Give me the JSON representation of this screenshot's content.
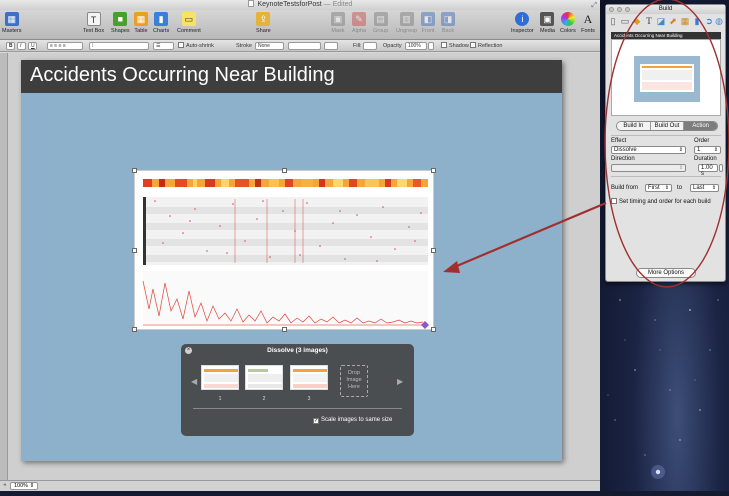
{
  "window": {
    "title": "KeynoteTestsforPost",
    "edited": "— Edited"
  },
  "toolbar": {
    "masters": "Masters",
    "text_box": "Text Box",
    "shapes": "Shapes",
    "table": "Table",
    "charts": "Charts",
    "comment": "Comment",
    "share": "Share",
    "mask": "Mask",
    "alpha": "Alpha",
    "group": "Group",
    "ungroup": "Ungroup",
    "front": "Front",
    "back": "Back",
    "inspector": "Inspector",
    "media": "Media",
    "colors": "Colors",
    "fonts": "Fonts"
  },
  "format_bar": {
    "bold": "B",
    "italic": "I",
    "underline": "U",
    "auto_shrink": "Auto-shrink",
    "stroke_label": "Stroke",
    "stroke_value": "None",
    "fill_label": "Fill:",
    "opacity_label": "Opacity",
    "opacity_value": "100%",
    "shadow_label": "Shadow",
    "reflection_label": "Reflection"
  },
  "slide": {
    "title": "Accidents Occurring Near Building"
  },
  "build_hud": {
    "title": "Dissolve (3 images)",
    "thumbnails": [
      {
        "number": "1"
      },
      {
        "number": "2"
      },
      {
        "number": "3"
      }
    ],
    "drop_text": "Drop Image Here",
    "scale_checkbox_label": "Scale images to same size",
    "scale_checked": true
  },
  "status": {
    "zoom": "100%"
  },
  "inspector": {
    "title": "Build",
    "preview_title": "Accidents Occurring Near Building",
    "tabs": [
      "Build In",
      "Build Out",
      "Action"
    ],
    "active_tab": "Action",
    "effect_label": "Effect",
    "effect_value": "Dissolve",
    "order_label": "Order",
    "order_value": "1",
    "direction_label": "Direction",
    "duration_label": "Duration",
    "duration_value": "1.00 s",
    "build_from_label": "Build from",
    "build_from_value": "First",
    "to_label": "to",
    "to_value": "Last",
    "set_timing_label": "Set timing and order for each build",
    "more_options": "More Options"
  },
  "colors": {
    "slide_bg": "#8eb1cb",
    "title_bar": "#3e3e3e",
    "annotation": "#a03030",
    "chart_red": "#e0463c"
  }
}
